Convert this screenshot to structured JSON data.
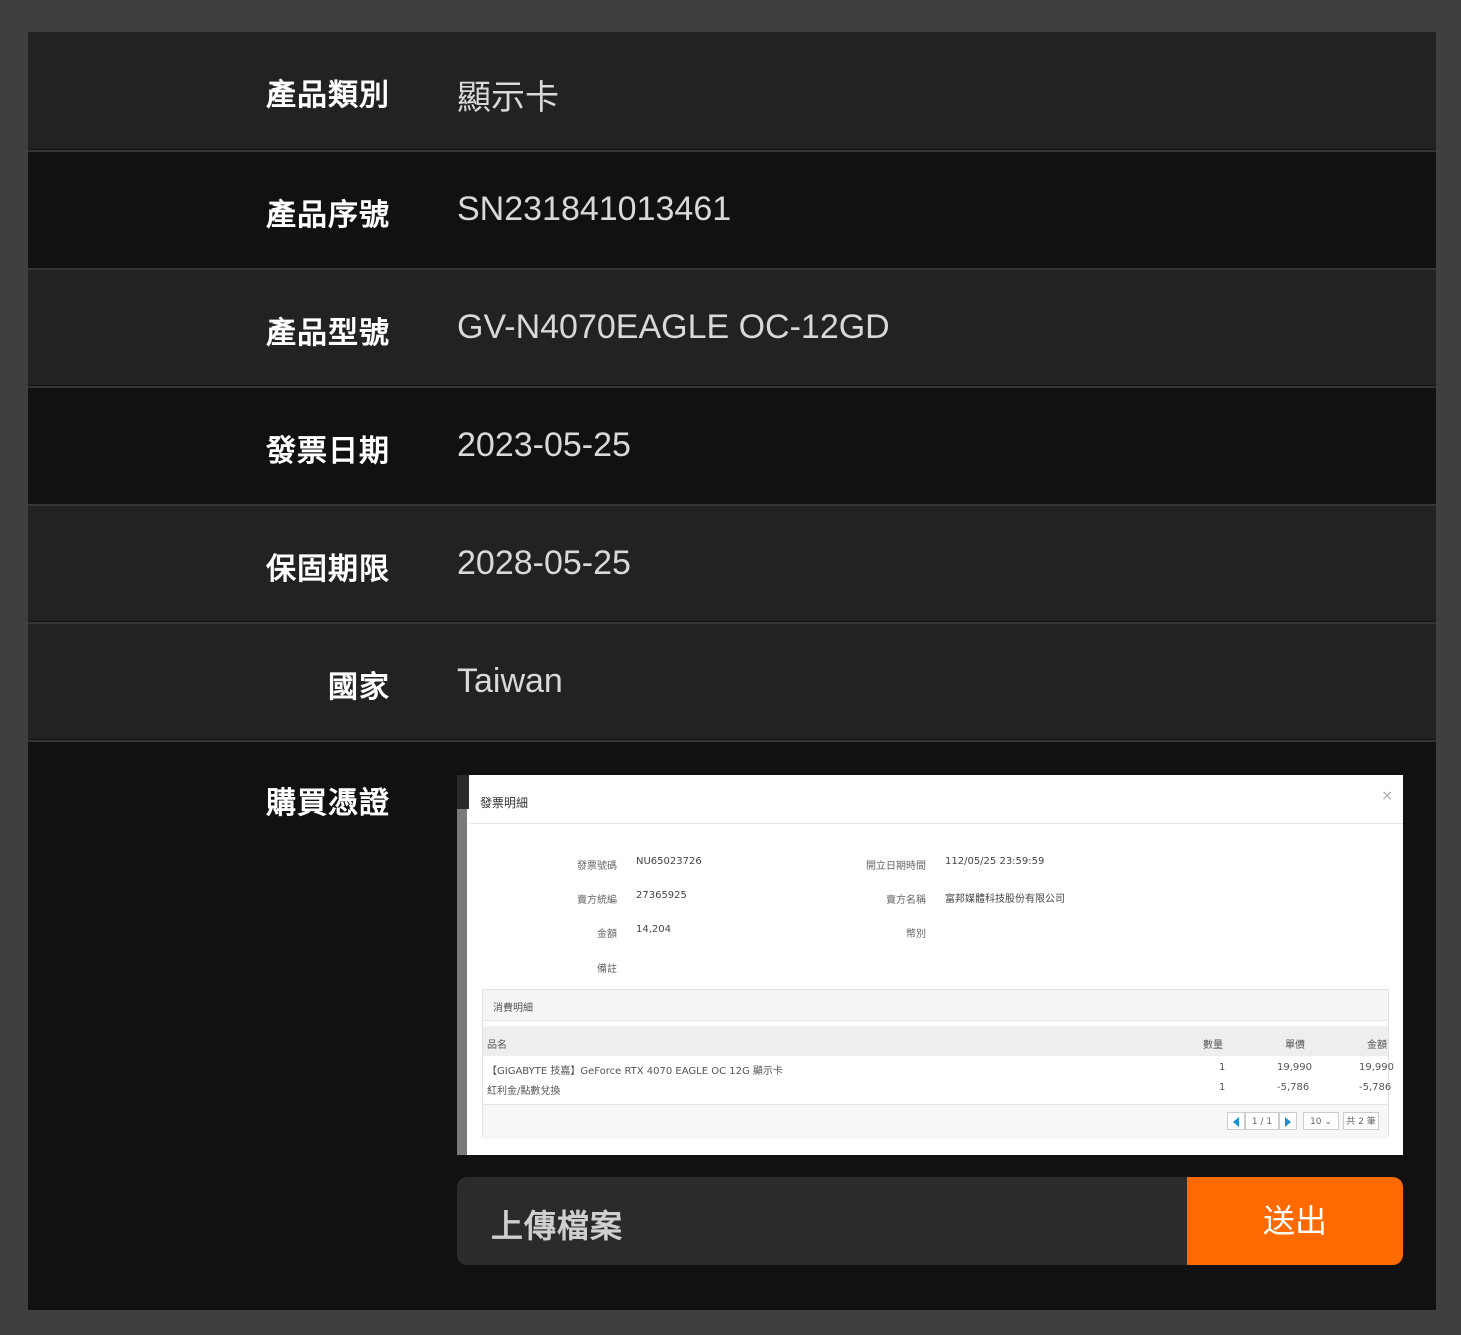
{
  "rows": [
    {
      "label": "產品類別",
      "value": "顯示卡"
    },
    {
      "label": "產品序號",
      "value": "SN231841013461"
    },
    {
      "label": "產品型號",
      "value": "GV-N4070EAGLE OC-12GD"
    },
    {
      "label": "發票日期",
      "value": "2023-05-25"
    },
    {
      "label": "保固期限",
      "value": "2028-05-25"
    },
    {
      "label": "國家",
      "value": "Taiwan"
    }
  ],
  "proof": {
    "label": "購買憑證",
    "invoice": {
      "title": "發票明細",
      "close_glyph": "×",
      "fields": {
        "invoice_no_label": "發票號碼",
        "invoice_no": "NU65023726",
        "datetime_label": "開立日期時間",
        "datetime": "112/05/25 23:59:59",
        "seller_id_label": "賣方統編",
        "seller_id": "27365925",
        "seller_name_label": "賣方名稱",
        "seller_name": "富邦媒體科技股份有限公司",
        "amount_label": "金額",
        "amount": "14,204",
        "currency_label": "幣別",
        "note_label": "備註"
      },
      "detail_title": "消費明細",
      "columns": [
        "品名",
        "數量",
        "單價",
        "金額"
      ],
      "items": [
        {
          "name": "【GIGABYTE 技嘉】GeForce RTX 4070 EAGLE OC 12G 顯示卡",
          "qty": "1",
          "price": "19,990",
          "total": "19,990"
        },
        {
          "name": "紅利金/點數兌換",
          "qty": "1",
          "price": "-5,786",
          "total": "-5,786"
        }
      ],
      "pager": {
        "page": "1 / 1",
        "page_size": "10",
        "count": "共 2 筆"
      }
    }
  },
  "upload": {
    "label": "上傳檔案",
    "submit_label": "送出"
  },
  "colors": {
    "accent": "#ff6a00",
    "row_light": "#222222",
    "row_dark": "#111111"
  }
}
